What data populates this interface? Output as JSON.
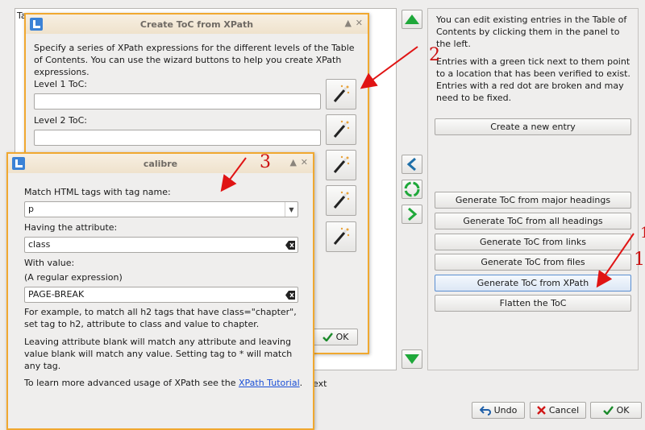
{
  "main": {
    "toc_tab_label": "Ta",
    "info_text": "You can edit existing entries in the Table of Contents by clicking them in the panel to the left.",
    "info_text2": "Entries with a green tick next to them point to a location that has been verified to exist. Entries with a red dot are broken and may need to be fixed.",
    "create_entry": "Create a new entry",
    "generate_buttons": [
      "Generate ToC from major headings",
      "Generate ToC from all headings",
      "Generate ToC from links",
      "Generate ToC from files",
      "Generate ToC from XPath",
      "Flatten the ToC"
    ],
    "behind_text": "ext",
    "undo_label": "Undo",
    "cancel_label": "Cancel",
    "ok_label": "OK"
  },
  "xpath_dialog": {
    "title": "Create ToC from XPath",
    "description": "Specify a series of XPath expressions for the different levels of the Table of Contents. You can use the wizard buttons to help you create XPath expressions.",
    "level1_label": "Level 1 ToC:",
    "level2_label": "Level 2 ToC:",
    "level1_value": "",
    "level2_value": "",
    "ok_label": "OK"
  },
  "calibre_dialog": {
    "title": "calibre",
    "tag_label": "Match HTML tags with tag name:",
    "tag_value": "p",
    "attr_label": "Having the attribute:",
    "attr_value": "class",
    "value_label": "With value:",
    "regex_hint": "(A regular expression)",
    "value_value": "PAGE-BREAK",
    "example_text": "For example, to match all h2 tags that have class=\"chapter\", set tag to h2, attribute to class and value to chapter.",
    "blank_text": "Leaving attribute blank will match any attribute and leaving value blank will match any value. Setting tag to * will match any tag.",
    "learn_text": "To learn more advanced usage of XPath see the",
    "learn_link": "XPath Tutorial",
    "learn_end": "."
  },
  "annotations": {
    "n1": "1",
    "n2": "2",
    "n3": "3",
    "n1b": "1"
  },
  "colors": {
    "accent": "#f0a830",
    "arrow": "#e01414",
    "link": "#1a4fd6",
    "green": "#1fa83a"
  }
}
